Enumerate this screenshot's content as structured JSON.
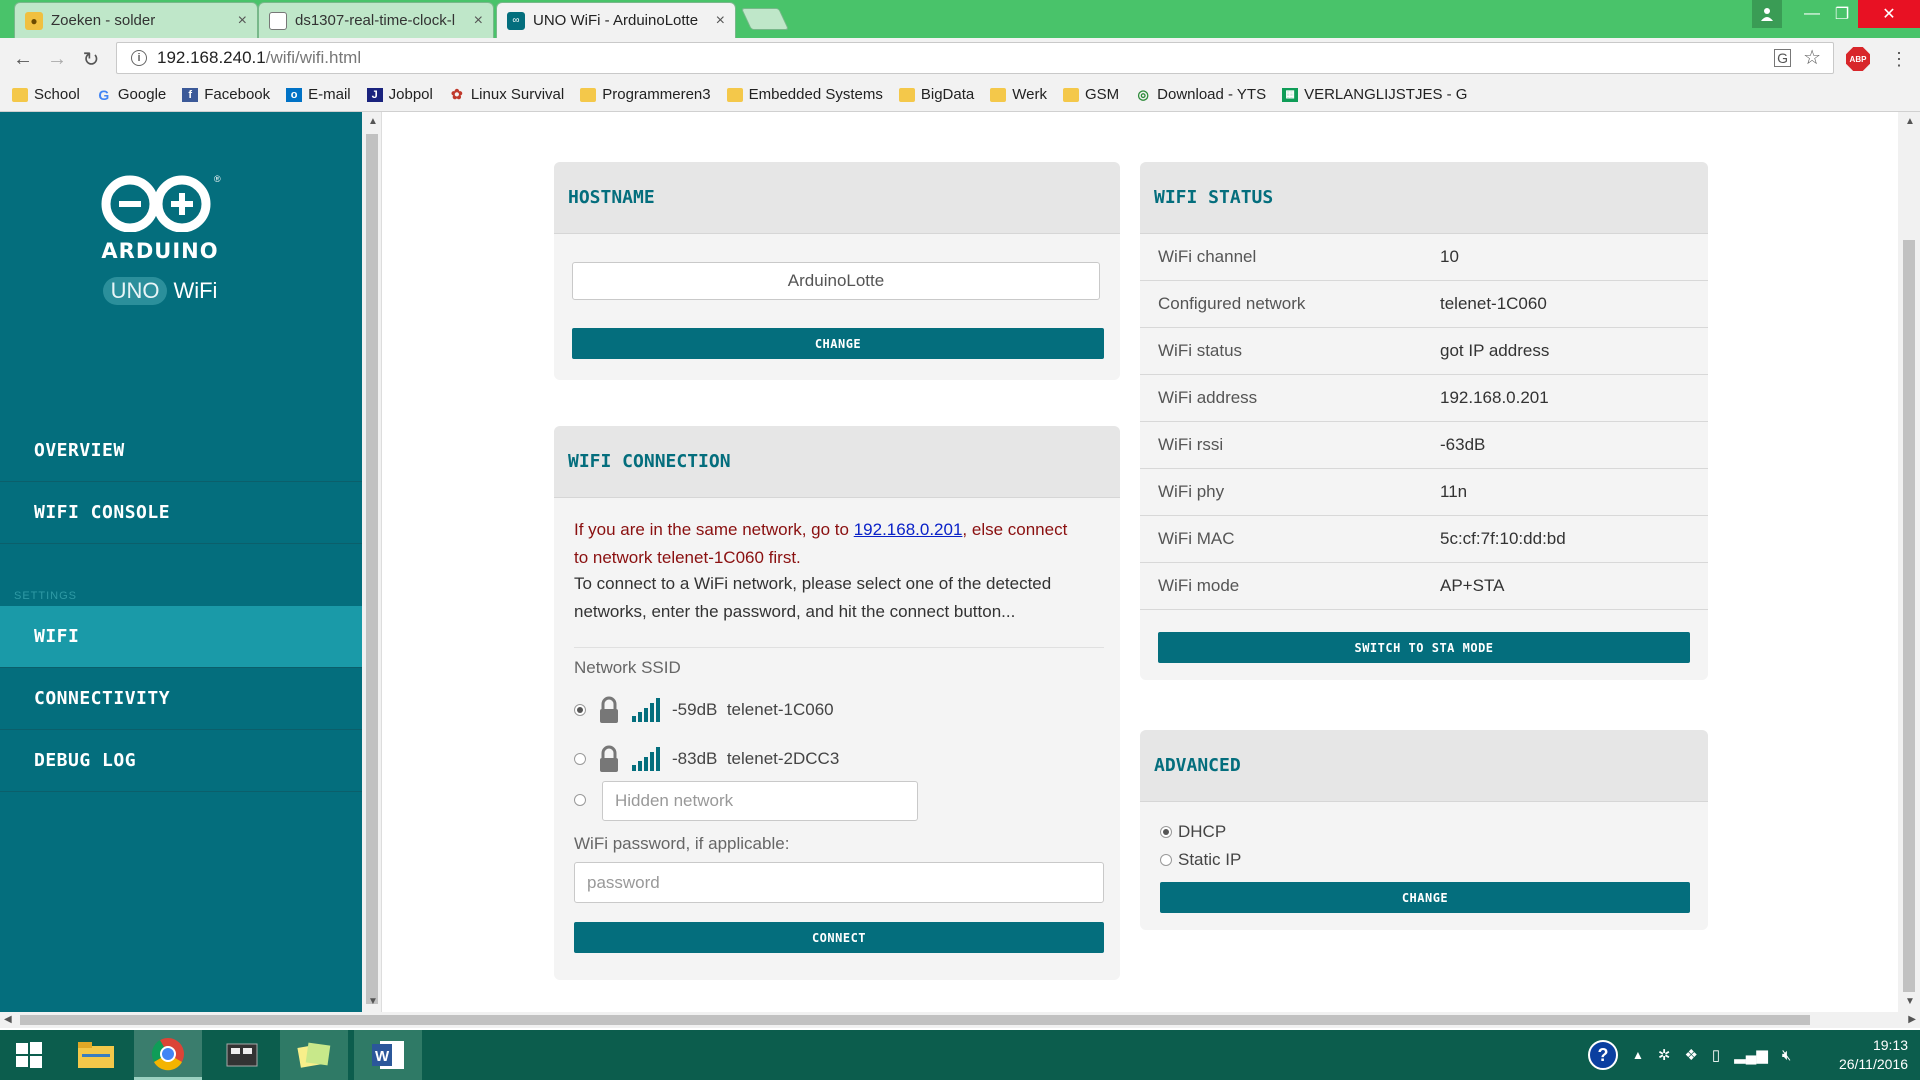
{
  "browser": {
    "tabs": [
      {
        "title": "Zoeken - solder"
      },
      {
        "title": "ds1307-real-time-clock-l"
      },
      {
        "title": "UNO WiFi - ArduinoLotte"
      }
    ],
    "url_host": "192.168.240.1",
    "url_path": "/wifi/wifi.html",
    "bookmarks": [
      {
        "label": "School",
        "icon": "folder-icon"
      },
      {
        "label": "Google",
        "icon": "google-icon"
      },
      {
        "label": "Facebook",
        "icon": "facebook-icon"
      },
      {
        "label": "E-mail",
        "icon": "outlook-icon"
      },
      {
        "label": "Jobpol",
        "icon": "jobpol-icon"
      },
      {
        "label": "Linux Survival",
        "icon": "linux-icon"
      },
      {
        "label": "Programmeren3",
        "icon": "folder-icon"
      },
      {
        "label": "Embedded Systems",
        "icon": "folder-icon"
      },
      {
        "label": "BigData",
        "icon": "folder-icon"
      },
      {
        "label": "Werk",
        "icon": "folder-icon"
      },
      {
        "label": "GSM",
        "icon": "folder-icon"
      },
      {
        "label": "Download - YTS",
        "icon": "yts-icon"
      },
      {
        "label": "VERLANGLIJSTJES - G",
        "icon": "sheets-icon"
      }
    ],
    "abp_badge": "ABP"
  },
  "sidebar": {
    "brand": "ARDUINO",
    "brand_reg": "®",
    "product_uno": "UNO",
    "product_wifi": "WiFi",
    "menu": [
      {
        "label": "OVERVIEW"
      },
      {
        "label": "WIFI CONSOLE"
      }
    ],
    "section_label": "SETTINGS",
    "settings_menu": [
      {
        "label": "WIFI",
        "active": true
      },
      {
        "label": "CONNECTIVITY"
      },
      {
        "label": "DEBUG LOG"
      }
    ]
  },
  "hostname": {
    "title": "HOSTNAME",
    "value": "ArduinoLotte",
    "button": "CHANGE"
  },
  "wifi_connection": {
    "title": "WIFI CONNECTION",
    "notice_pre": "If you are in the same network, go to ",
    "notice_link": "192.168.0.201",
    "notice_post1": ", else connect",
    "notice_post2": "to network telenet-1C060 first.",
    "instructions1": "To connect to a WiFi network, please select one of the detected",
    "instructions2": "networks, enter the password, and hit the connect button...",
    "ssid_label": "Network SSID",
    "networks": [
      {
        "rssi": "-59dB",
        "ssid": "telenet-1C060",
        "selected": true
      },
      {
        "rssi": "-83dB",
        "ssid": "telenet-2DCC3",
        "selected": false
      }
    ],
    "hidden_placeholder": "Hidden network",
    "password_label": "WiFi password, if applicable:",
    "password_placeholder": "password",
    "button": "CONNECT"
  },
  "wifi_status": {
    "title": "WIFI STATUS",
    "rows": [
      {
        "key": "WiFi channel",
        "value": "10"
      },
      {
        "key": "Configured network",
        "value": "telenet-1C060"
      },
      {
        "key": "WiFi status",
        "value": "got IP address"
      },
      {
        "key": "WiFi address",
        "value": "192.168.0.201"
      },
      {
        "key": "WiFi rssi",
        "value": "-63dB"
      },
      {
        "key": "WiFi phy",
        "value": "11n"
      },
      {
        "key": "WiFi MAC",
        "value": "5c:cf:7f:10:dd:bd"
      },
      {
        "key": "WiFi mode",
        "value": "AP+STA"
      }
    ],
    "button": "SWITCH TO STA MODE"
  },
  "advanced": {
    "title": "ADVANCED",
    "options": [
      {
        "label": "DHCP",
        "selected": true
      },
      {
        "label": "Static IP",
        "selected": false
      }
    ],
    "button": "CHANGE"
  },
  "taskbar": {
    "time": "19:13",
    "date": "26/11/2016"
  },
  "colors": {
    "teal": "#046e7d",
    "teal_active": "#1a9aa8",
    "chrome_green": "#49c36a"
  }
}
